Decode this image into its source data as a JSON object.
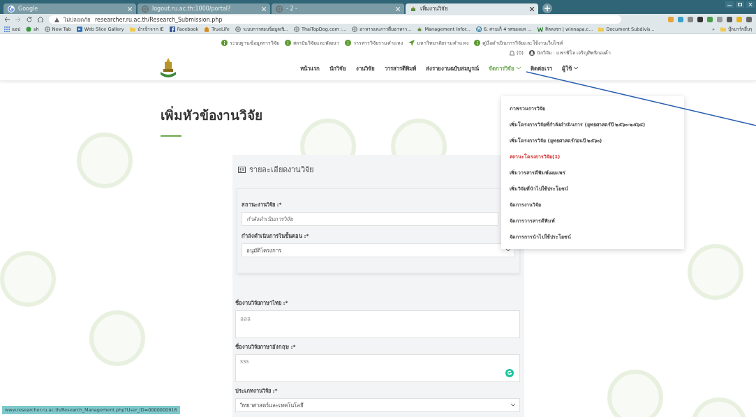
{
  "browser": {
    "tabs": [
      {
        "title": "Google",
        "selected": false
      },
      {
        "title": "logout.ru.ac.th:1000/portal?",
        "selected": false
      },
      {
        "title": "- 2 -",
        "selected": false
      },
      {
        "title": "เพิ่มงานวิจัย",
        "selected": true
      }
    ],
    "security": "ไม่ปลอดภัย",
    "url": "researcher.ru.ac.th/Research_Submission.php",
    "bookmarks": [
      "แอป",
      "sh",
      "New Tab",
      "Web Slice Gallery",
      "นำเข้าจาก IE",
      "Facebook",
      "TrueLife",
      "ระบบการสอบข้อมูลเชิ...",
      "ThaiTopDog.com :...",
      "อาหารและการดื่มอาหาร...",
      "Management Infor...",
      "6. สายเก็ 4 รสของแท ...",
      "สิลลงชา | winnapa.c...",
      "Document Subdivis..."
    ],
    "more_bookmarks": "»",
    "other_bookmarks": "บุ๊กมาร์กอื่นๆ"
  },
  "top_links": [
    "ระบบฐานข้อมูลการวิจัย",
    "สถาบันวิจัยและพัฒนา",
    "วารสารวิจัยรามคำแหง",
    "มหาวิทยาลัยรามคำแหง",
    "คู่มือดำเนินการวิจัยและใช้งานเว็บไซต์"
  ],
  "notifications": "(0)",
  "user": "นักวิจัย : แพรพิไล เจริญสิทธิกองค้า",
  "nav": [
    {
      "label": "หน้าแรก",
      "kind": "link",
      "selected": false
    },
    {
      "label": "นักวิจัย",
      "kind": "link",
      "selected": false
    },
    {
      "label": "งานวิจัย",
      "kind": "link",
      "selected": false
    },
    {
      "label": "วารสารตีพิมพ์",
      "kind": "link",
      "selected": false
    },
    {
      "label": "ส่งรายงานฉบับสมบูรณ์",
      "kind": "link",
      "selected": false
    },
    {
      "label": "จัดการวิจัย",
      "kind": "menu",
      "selected": true
    },
    {
      "label": "ติดต่อเรา",
      "kind": "link",
      "selected": false
    },
    {
      "label": "ผู้ใช้",
      "kind": "menu",
      "selected": false
    }
  ],
  "menu": [
    {
      "label": "ภาพรวมการวิจัย",
      "kind": "item"
    },
    {
      "label": "เพิ่มโครงการวิจัยที่กำลังดำเนินการ (ยุทธศาสตร์ปี ๒๕๖๐-๒๕๖๔)",
      "kind": "item"
    },
    {
      "label": "เพิ่มโครงการวิจัย (ยุทธศาสตร์ก่อนปี ๒๕๖๐)",
      "kind": "item"
    },
    {
      "label": "สถานะโครงการวิจัย(1)",
      "kind": "alert"
    },
    {
      "label": "เพิ่มวารสารตีพิมพ์เผยแพร่",
      "kind": "item"
    },
    {
      "label": "เพิ่มวิจัยที่นำไปใช้ประโยชน์",
      "kind": "item"
    },
    {
      "label": "จัดการงานวิจัย",
      "kind": "item"
    },
    {
      "label": "จัดการวารสารตีพิมพ์",
      "kind": "item"
    },
    {
      "label": "จัดการการนำไปใช้ประโยชน์",
      "kind": "item"
    }
  ],
  "page_title": "เพิ่มหัวข้องานวิจัย",
  "form": {
    "title": "รายละเอียดงานวิจัย",
    "status_fields": [
      {
        "label": "สถานะงานวิจัย :*",
        "kind": "readonly",
        "value": "กำลังดำเนินการวิจัย"
      },
      {
        "label": "กำลังดำเนินการในขั้นตอน :*",
        "kind": "select",
        "value": "อนุมัติโครงการ"
      }
    ],
    "fields": [
      {
        "label": "ชื่องานวิจัยภาษาไทย :*",
        "kind": "textarea",
        "value": "ลลล"
      },
      {
        "label": "ชื่องานวิจัยภาษาอังกฤษ :*",
        "kind": "textarea",
        "value": "sss"
      },
      {
        "label": "ประเภทงานวิจัย :*",
        "kind": "select",
        "value": "วิทยาศาสตร์และเทคโนโลยี"
      }
    ]
  },
  "status_url": "www.researcher.ru.ac.th/Research_Management.php?User_ID=0000000916"
}
